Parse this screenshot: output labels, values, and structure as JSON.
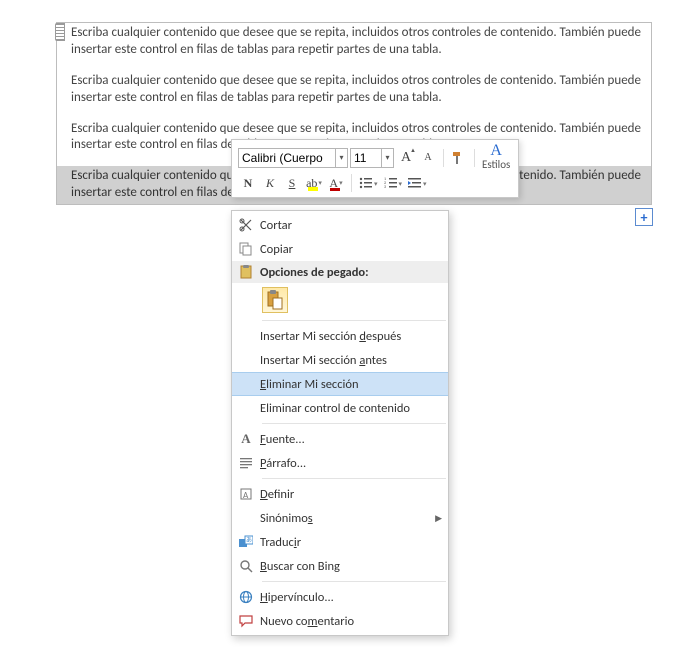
{
  "doc": {
    "para_text": "Escriba cualquier contenido que desee que se repita, incluidos otros controles de contenido. También puede insertar este control en filas de tablas para repetir partes de una tabla."
  },
  "plus": "+",
  "mini_toolbar": {
    "font_name": "Calibri (Cuerpo",
    "font_size": "11",
    "grow_font": "A",
    "shrink_font": "A",
    "bold": "N",
    "italic": "K",
    "underline": "S",
    "font_color_letter": "A",
    "highlight_letter": "ab",
    "estilos_label": "Estilos",
    "estilos_a": "A"
  },
  "context_menu": {
    "cortar": "Cortar",
    "copiar": "Copiar",
    "opciones_pegado": "Opciones de pegado:",
    "insertar_despues_pre": "Insertar Mi sección ",
    "insertar_despues_u": "d",
    "insertar_despues_post": "espués",
    "insertar_antes_pre": "Insertar Mi sección ",
    "insertar_antes_u": "a",
    "insertar_antes_post": "ntes",
    "eliminar_mi_u": "E",
    "eliminar_mi_post": "liminar Mi sección",
    "eliminar_control": "Eliminar control de contenido",
    "fuente_u": "F",
    "fuente_post": "uente...",
    "parrafo_u": "P",
    "parrafo_post": "árrafo...",
    "definir_u": "D",
    "definir_post": "efinir",
    "sinonimos_pre": "Sinónimo",
    "sinonimos_u": "s",
    "traducir_pre": "Traduc",
    "traducir_u": "i",
    "traducir_post": "r",
    "buscar_u": "B",
    "buscar_post": "uscar con Bing",
    "hipervinculo_u": "H",
    "hipervinculo_post": "ipervínculo...",
    "nuevo_pre": "Nuevo co",
    "nuevo_u": "m",
    "nuevo_post": "entario"
  }
}
